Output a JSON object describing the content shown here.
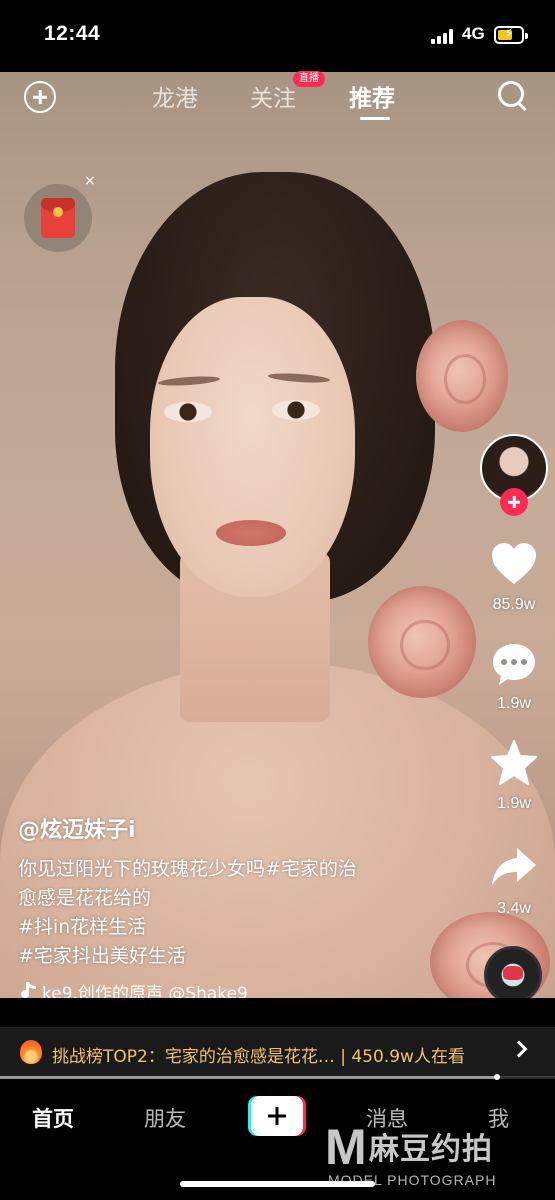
{
  "status_bar": {
    "time": "12:44",
    "network": "4G",
    "battery_color": "#f5c518"
  },
  "top_nav": {
    "tabs": [
      {
        "label": "龙港",
        "active": false
      },
      {
        "label": "关注",
        "active": false
      },
      {
        "label": "推荐",
        "active": true
      }
    ],
    "live_badge": "直播",
    "icons": [
      "add-circle-icon",
      "search-icon"
    ]
  },
  "red_packet": {
    "icon": "red-envelope-icon",
    "close": "×"
  },
  "right_rail": {
    "avatar": "creator-avatar",
    "like_count": "85.9w",
    "comment_count": "1.9w",
    "favorite_count": "1.9w",
    "share_count": "3.4w"
  },
  "caption": {
    "author": "@炫迈妹子i",
    "lines": [
      "你见过阳光下的玫瑰花少女吗#宅家的治",
      "愈感是花花给的",
      "#抖in花样生活",
      "#宅家抖出美好生活"
    ],
    "music": "ke9.创作的原声    @Shake9"
  },
  "challenge_bar": {
    "text": "挑战榜TOP2：宅家的治愈感是花花…  | 450.9w人在看"
  },
  "playback": {
    "progress": 0.895
  },
  "bottom_nav": {
    "items": [
      {
        "label": "首页",
        "active": true
      },
      {
        "label": "朋友",
        "active": false
      },
      {
        "label": "消息",
        "active": false
      },
      {
        "label": "我",
        "active": false
      }
    ]
  },
  "watermark": {
    "letter": "M",
    "cn": "麻豆约拍",
    "en": "MODEL PHOTOGRAPH"
  },
  "colors": {
    "accent": "#fe2c55",
    "cyan": "#25f4ee",
    "challenge_text": "#f5c26b"
  }
}
